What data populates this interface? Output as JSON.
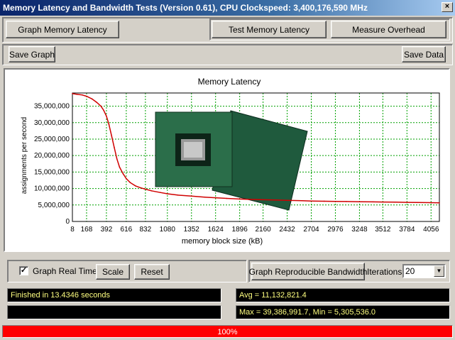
{
  "window": {
    "title": "Memory Latency and Bandwidth Tests (Version 0.61), CPU Clockspeed: 3,400,176,590 MHz",
    "close_glyph": "×"
  },
  "toolbar": {
    "graph_memory_latency": "Graph Memory Latency",
    "test_memory_latency": "Test Memory Latency",
    "measure_overhead": "Measure Overhead",
    "save_graph": "Save Graph",
    "save_data": "Save Data"
  },
  "controls": {
    "graph_real_time_label": "Graph Real Time",
    "graph_real_time_checked": "✓",
    "scale": "Scale",
    "reset": "Reset",
    "graph_reproducible_bandwidth": "Graph Reproducible Bandwidth",
    "iterations_label": "Iterations:",
    "iterations_value": "20",
    "iterations_arrow": "▼"
  },
  "status": {
    "finished": "Finished in 13.4346 seconds",
    "blank": "",
    "avg": "Avg = 11,132,821.4",
    "maxmin": "Max = 39,386,991.7, Min = 5,305,536.0",
    "progress_text": "100%",
    "progress_fraction": 1.0
  },
  "colors": {
    "series": "#d00000",
    "grid": "#00a000",
    "status_text": "#ffff80",
    "progress": "#ff0000"
  },
  "chart_data": {
    "type": "line",
    "title": "Memory Latency",
    "xlabel": "memory block size (kB)",
    "ylabel": "assignments per second",
    "xlim": [
      8,
      4150
    ],
    "ylim": [
      0,
      39000000
    ],
    "grid": true,
    "x_ticks": [
      "8",
      "168",
      "392",
      "616",
      "832",
      "1080",
      "1352",
      "1624",
      "1896",
      "2160",
      "2432",
      "2704",
      "2976",
      "3248",
      "3512",
      "3784",
      "4056"
    ],
    "y_ticks": [
      "0",
      "5,000,000",
      "10,000,000",
      "15,000,000",
      "20,000,000",
      "25,000,000",
      "30,000,000",
      "35,000,000"
    ],
    "series": [
      {
        "x": [
          8,
          60,
          120,
          168,
          230,
          280,
          330,
          360,
          392,
          420,
          450,
          480,
          510,
          540,
          580,
          616,
          660,
          720,
          780,
          832,
          900,
          1000,
          1080,
          1200,
          1352,
          1500,
          1624,
          1750,
          1896,
          2000,
          2160,
          2300,
          2432,
          2600,
          2704,
          2850,
          2976,
          3100,
          3248,
          3400,
          3512,
          3650,
          3784,
          3900,
          4056,
          4150
        ],
        "y": [
          38800000,
          38600000,
          38400000,
          38000000,
          37200000,
          36200000,
          35000000,
          33800000,
          32000000,
          29500000,
          26000000,
          22500000,
          19000000,
          16500000,
          14500000,
          13000000,
          11800000,
          10800000,
          10200000,
          9800000,
          9300000,
          8800000,
          8400000,
          8000000,
          7700000,
          7400000,
          7200000,
          7000000,
          6800000,
          6700000,
          6600000,
          6500000,
          6400000,
          6300000,
          6200000,
          6150000,
          6100000,
          6050000,
          6000000,
          5950000,
          5900000,
          5850000,
          5800000,
          5750000,
          5700000,
          5650000
        ]
      }
    ]
  }
}
